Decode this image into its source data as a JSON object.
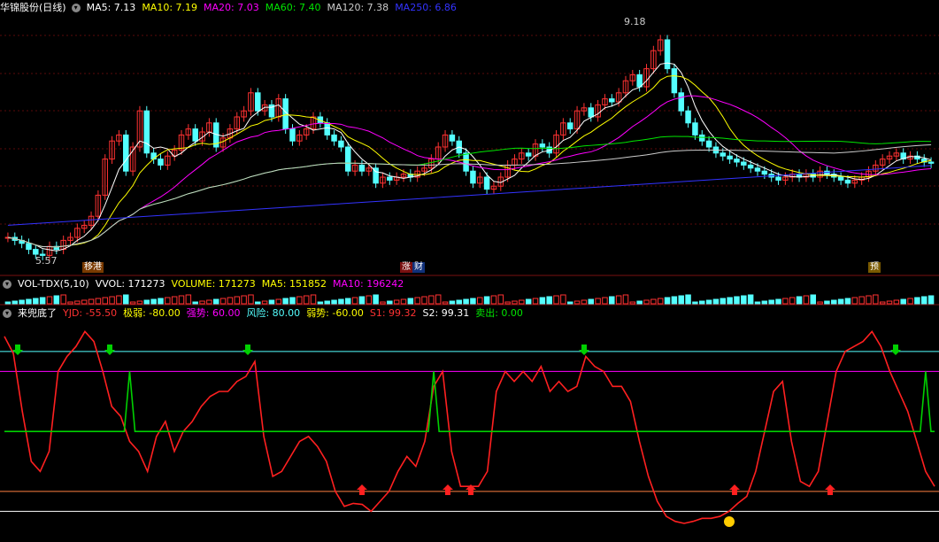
{
  "main_header": {
    "title": "华锦股份(日线)",
    "ma5": "MA5: 7.13",
    "ma10": "MA10: 7.19",
    "ma20": "MA20: 7.03",
    "ma60": "MA60: 7.40",
    "ma120": "MA120: 7.38",
    "ma250": "MA250: 6.86"
  },
  "vol_header": {
    "title": "VOL-TDX(5,10)",
    "vvol": "VVOL: 171273",
    "volume": "VOLUME: 171273",
    "ma5": "MA5: 151852",
    "ma10": "MA10: 196242"
  },
  "ind_header": {
    "title": "来兜底了",
    "yjd": "YJD: -55.50",
    "jiruo": "极弱: -80.00",
    "qiangshi": "强势: 60.00",
    "fengxian": "风险: 80.00",
    "ruoshi": "弱势: -60.00",
    "s1": "S1: 99.32",
    "s2": "S2: 99.31",
    "maichu": "卖出: 0.00"
  },
  "annotations": {
    "high_price": "9.18",
    "low_price": "5.57",
    "tag_left": "移港",
    "tag_mid1": "涨",
    "tag_mid2": "财",
    "tag_right": "预"
  },
  "colors": {
    "up": "#ff3232",
    "down": "#54ffff",
    "ma5": "#ffffff",
    "ma10": "#ffff00",
    "ma20": "#ff00ff",
    "ma60": "#00e600",
    "ma120": "#cccccc",
    "ma250": "#3333ff",
    "yjd": "#ff2020",
    "signal": "#00d000"
  },
  "chart_data": {
    "type": "line",
    "price_range": [
      5.4,
      9.4
    ],
    "candles_close": [
      5.9,
      5.85,
      5.8,
      5.7,
      5.62,
      5.6,
      5.75,
      5.7,
      5.85,
      5.9,
      6.05,
      6.1,
      6.25,
      6.6,
      7.2,
      7.5,
      7.6,
      7.0,
      7.4,
      8.0,
      7.3,
      7.2,
      7.1,
      7.25,
      7.35,
      7.6,
      7.7,
      7.5,
      7.65,
      7.8,
      7.4,
      7.55,
      7.7,
      7.9,
      8.0,
      8.3,
      8.0,
      8.1,
      7.9,
      8.2,
      7.7,
      7.5,
      7.6,
      7.7,
      7.9,
      7.8,
      7.6,
      7.5,
      7.4,
      7.0,
      7.1,
      7.0,
      7.05,
      6.8,
      6.9,
      6.85,
      6.9,
      6.95,
      6.9,
      7.0,
      7.05,
      7.2,
      7.4,
      7.6,
      7.5,
      7.3,
      7.0,
      6.8,
      6.9,
      6.7,
      6.75,
      6.9,
      7.1,
      7.2,
      7.3,
      7.25,
      7.45,
      7.4,
      7.3,
      7.6,
      7.8,
      7.7,
      8.0,
      8.05,
      7.9,
      8.1,
      8.2,
      8.15,
      8.3,
      8.5,
      8.6,
      8.4,
      8.7,
      9.0,
      9.18,
      8.7,
      8.3,
      8.0,
      7.8,
      7.6,
      7.5,
      7.4,
      7.3,
      7.25,
      7.2,
      7.15,
      7.1,
      7.05,
      7.0,
      6.95,
      6.9,
      6.85,
      6.9,
      6.95,
      6.9,
      6.95,
      6.9,
      7.0,
      6.95,
      6.9,
      6.85,
      6.8,
      6.85,
      6.9,
      7.0,
      7.1,
      7.2,
      7.25,
      7.3,
      7.2,
      7.25,
      7.2,
      7.15,
      7.13
    ],
    "yjd_range": [
      -100,
      110
    ],
    "yjd": [
      95,
      78,
      20,
      -30,
      -40,
      -20,
      60,
      75,
      85,
      100,
      90,
      60,
      25,
      15,
      -10,
      -20,
      -40,
      -5,
      10,
      -20,
      0,
      10,
      25,
      35,
      40,
      40,
      50,
      55,
      70,
      -5,
      -45,
      -40,
      -25,
      -10,
      -5,
      -15,
      -30,
      -60,
      -75,
      -72,
      -73,
      -80,
      -70,
      -60,
      -40,
      -25,
      -35,
      -10,
      45,
      60,
      -20,
      -55,
      -55,
      -55,
      -40,
      40,
      60,
      50,
      60,
      50,
      65,
      40,
      50,
      40,
      45,
      75,
      65,
      60,
      45,
      45,
      30,
      -10,
      -45,
      -70,
      -85,
      -90,
      -92,
      -90,
      -87,
      -87,
      -85,
      -80,
      -72,
      -65,
      -40,
      0,
      40,
      50,
      -10,
      -50,
      -55,
      -40,
      10,
      60,
      80,
      85,
      90,
      100,
      85,
      60,
      40,
      20,
      -10,
      -40,
      -55
    ],
    "signal_range": [
      -100,
      110
    ],
    "signal_base": 0,
    "signal_peaks_index": [
      14,
      48,
      103
    ],
    "levels": {
      "fengxian": 80,
      "qiangshi": 60,
      "ruoshi": -60,
      "jiruo": -80
    }
  }
}
